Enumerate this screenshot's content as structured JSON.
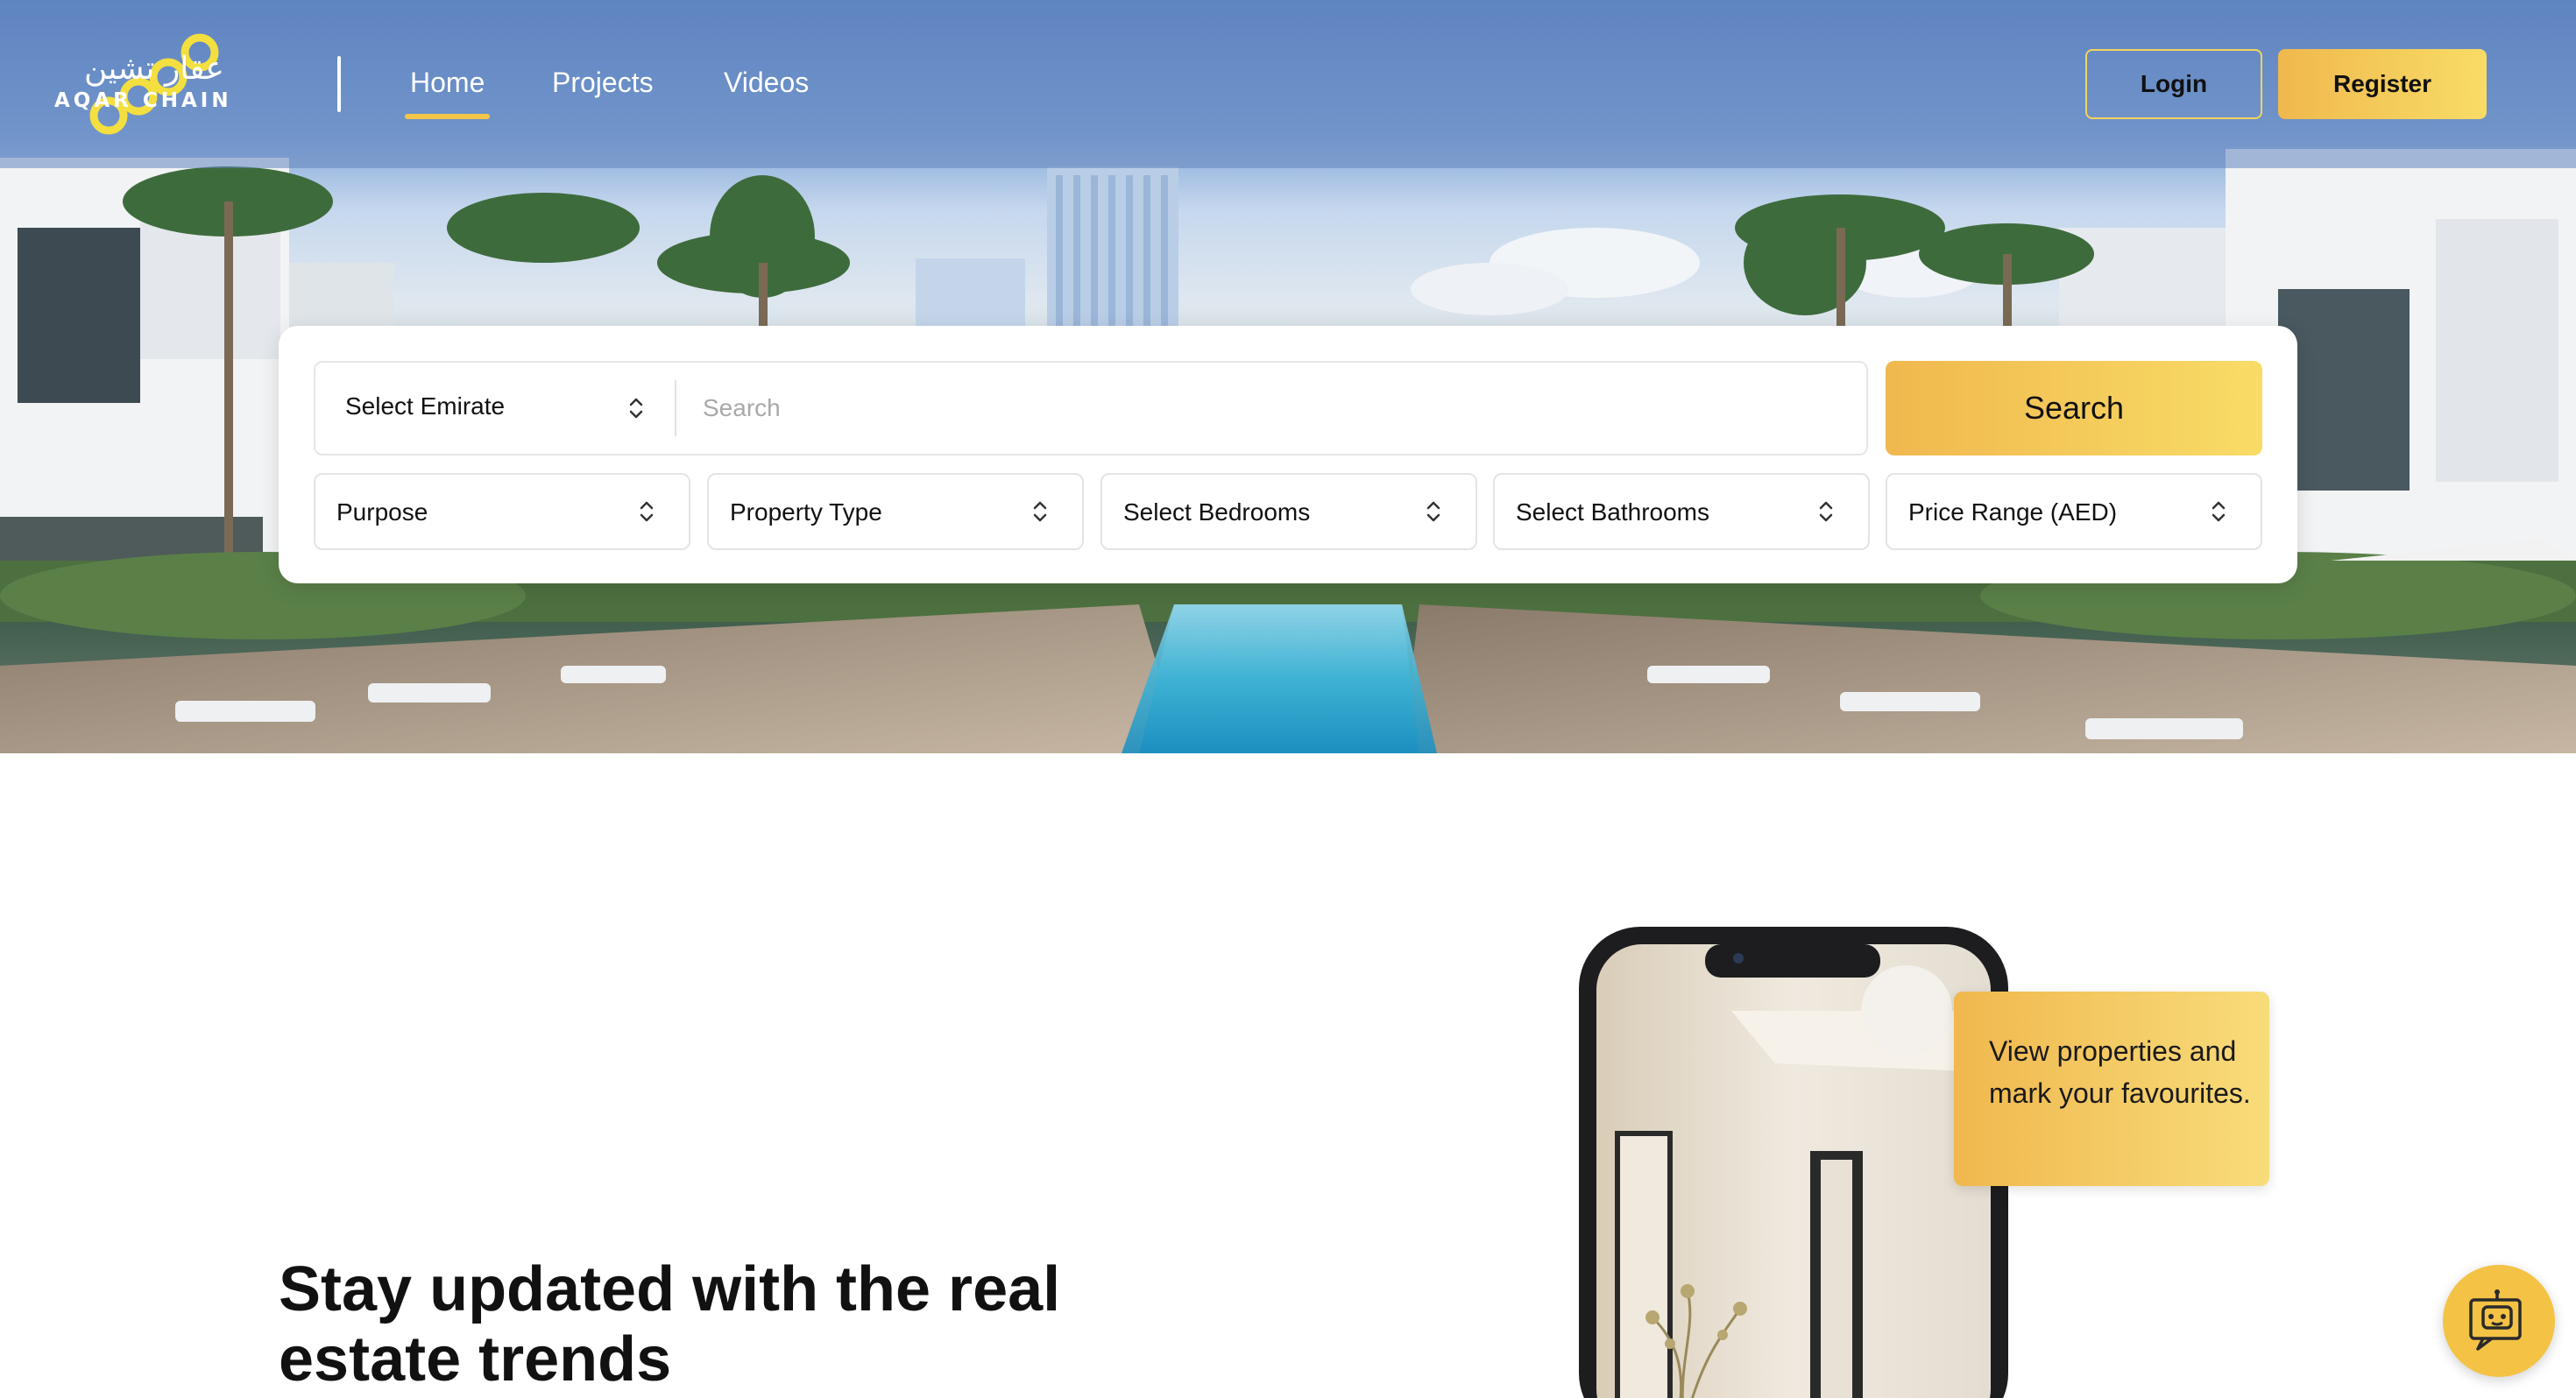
{
  "brand": {
    "name_ar": "عقار تشين",
    "name_en": "AQAR CHAIN",
    "logo_icon": "chain-links-icon",
    "accent": "#F3C64A",
    "accent_gradient": [
      "#F0B84E",
      "#F8DC66"
    ]
  },
  "nav": {
    "links": [
      {
        "label": "Home",
        "active": true
      },
      {
        "label": "Projects",
        "active": false
      },
      {
        "label": "Videos",
        "active": false
      }
    ],
    "login_label": "Login",
    "register_label": "Register"
  },
  "search": {
    "emirate_select": "Select Emirate",
    "placeholder": "Search",
    "button_label": "Search",
    "filters": [
      {
        "label": "Purpose"
      },
      {
        "label": "Property Type"
      },
      {
        "label": "Select Bedrooms"
      },
      {
        "label": "Select Bathrooms"
      },
      {
        "label": "Price Range (AED)"
      }
    ],
    "select_icon": "up-down-chevron-icon"
  },
  "promo": {
    "headline": "Stay updated with the real estate trends",
    "callout": "View properties and mark your favourites.",
    "phone_image": "interior-room-photo"
  },
  "chat": {
    "icon": "chatbot-icon"
  }
}
